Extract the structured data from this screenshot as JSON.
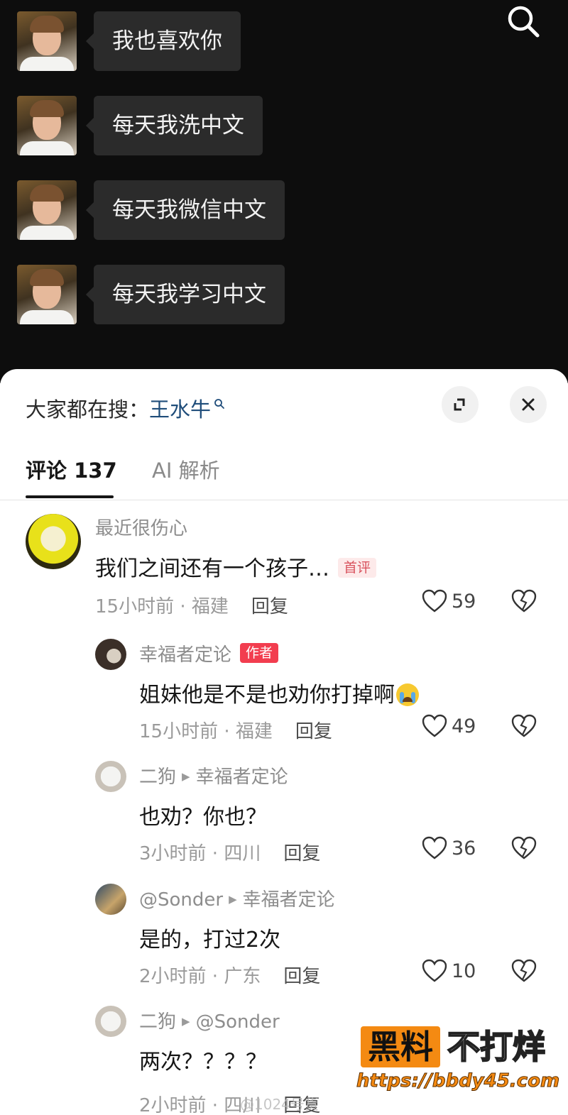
{
  "video": {
    "chat_messages": [
      {
        "text": "我也喜欢你"
      },
      {
        "text": "每天我洗中文"
      },
      {
        "text": "每天我微信中文"
      },
      {
        "text": "每天我学习中文"
      }
    ]
  },
  "sheet": {
    "hot_search_label": "大家都在搜：",
    "hot_search_term": "王水牛",
    "tabs": [
      {
        "label": "评论 137"
      },
      {
        "label": "AI 解析"
      }
    ],
    "comments": [
      {
        "user": "最近很伤心",
        "text": "我们之间还有一个孩子…",
        "badge": "首评",
        "time": "15小时前",
        "location": "福建",
        "reply_label": "回复",
        "likes": "59"
      },
      {
        "user": "幸福者定论",
        "badge": "作者",
        "text": "姐妹他是不是也劝你打掉啊",
        "time": "15小时前",
        "location": "福建",
        "reply_label": "回复",
        "likes": "49"
      },
      {
        "user": "二狗",
        "reply_to": "幸福者定论",
        "text": "也劝？你也？",
        "time": "3小时前",
        "location": "四川",
        "reply_label": "回复",
        "likes": "36"
      },
      {
        "user": "@Sonder",
        "reply_to": "幸福者定论",
        "text": "是的，打过2次",
        "time": "2小时前",
        "location": "广东",
        "reply_label": "回复",
        "likes": "10"
      },
      {
        "user": "二狗",
        "reply_to": "@Sonder",
        "text": "两次？？？？",
        "time": "2小时前",
        "location": "四川",
        "reply_label": "回复"
      }
    ]
  },
  "watermark": {
    "brand_box": "黑料",
    "brand_rest": "不打烊",
    "url": "https://bbdy45.com",
    "weibo": "@1024号货"
  },
  "colors": {
    "video_bg": "#0d0d0d",
    "bubble_bg": "#2b2b2b",
    "hot_term": "#1f4d7a",
    "author_badge": "#f23d4f",
    "first_badge_text": "#d9535e",
    "watermark_orange": "#f48a12"
  }
}
